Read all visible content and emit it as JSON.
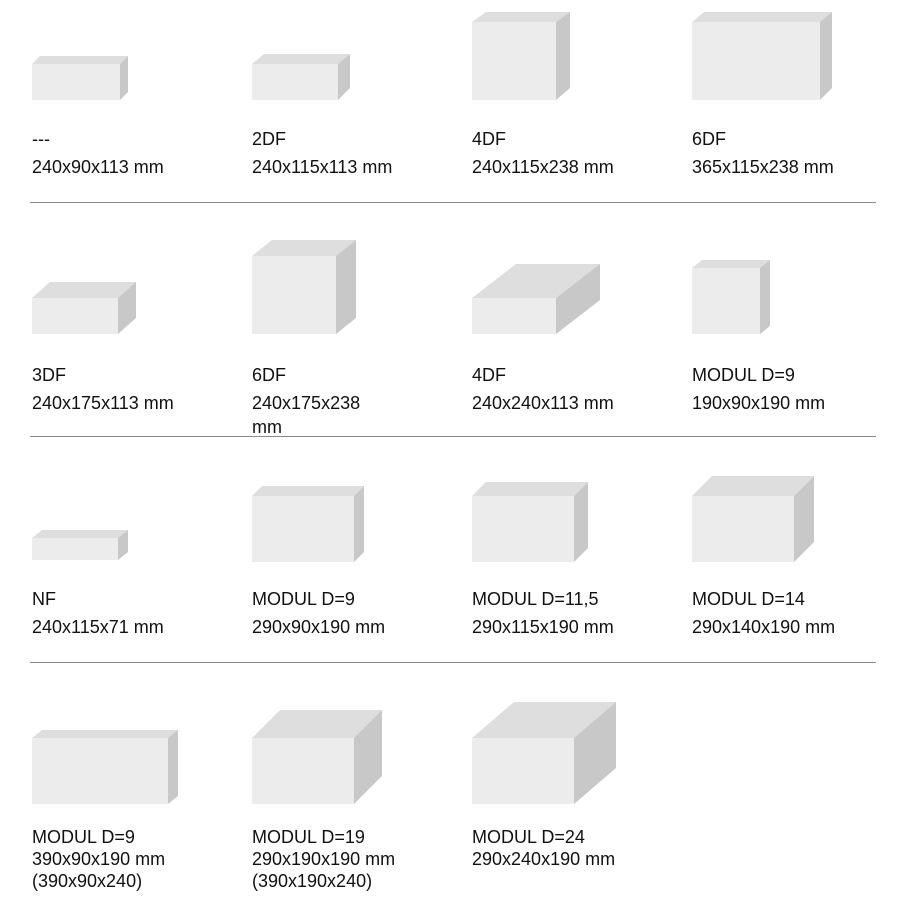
{
  "bricks": [
    {
      "label": "---",
      "size": "240x90x113 mm"
    },
    {
      "label": "2DF",
      "size": "240x115x113 mm"
    },
    {
      "label": "4DF",
      "size": "240x115x238 mm"
    },
    {
      "label": "6DF",
      "size": "365x115x238 mm"
    },
    {
      "label": "3DF",
      "size": "240x175x113 mm"
    },
    {
      "label": "6DF",
      "size": "240x175x238",
      "size_wrap": "mm"
    },
    {
      "label": "4DF",
      "size": "240x240x113 mm"
    },
    {
      "label": "MODUL D=9",
      "size": "190x90x190 mm"
    },
    {
      "label": "NF",
      "size": "240x115x71 mm"
    },
    {
      "label": "MODUL D=9",
      "size": "290x90x190 mm"
    },
    {
      "label": "MODUL D=11,5",
      "size": "290x115x190 mm"
    },
    {
      "label": "MODUL D=14",
      "size": "290x140x190 mm"
    },
    {
      "label": "MODUL D=9",
      "size": "390x90x190 mm",
      "alt": "(390x90x240)"
    },
    {
      "label": "MODUL D=19",
      "size": "290x190x190 mm",
      "alt": "(390x190x240)"
    },
    {
      "label": "MODUL D=24",
      "size": "290x240x190 mm"
    }
  ],
  "colors": {
    "front": "#ececec",
    "top": "#dedede",
    "side": "#c8c8c8",
    "rule": "#8a8a8a"
  }
}
